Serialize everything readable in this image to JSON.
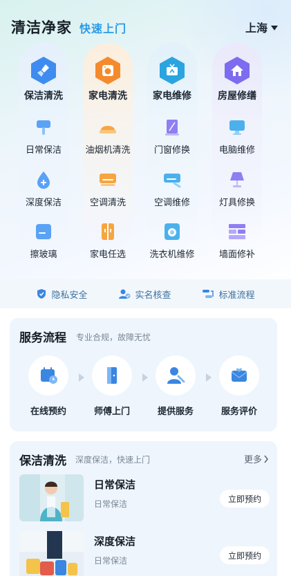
{
  "header": {
    "title": "清洁净家",
    "slogan": "快速上门",
    "city": "上海"
  },
  "categories": {
    "top": [
      {
        "label": "保洁清洗",
        "icon": "broom-icon",
        "color": "#3e8cf0"
      },
      {
        "label": "家电清洗",
        "icon": "washing-machine-icon",
        "color": "#f58a2c"
      },
      {
        "label": "家电维修",
        "icon": "tv-icon",
        "color": "#2ba4e0"
      },
      {
        "label": "房屋修缮",
        "icon": "house-icon",
        "color": "#7d6cf0"
      }
    ],
    "rows": [
      [
        {
          "label": "日常保洁",
          "icon": "mop-icon"
        },
        {
          "label": "油烟机清洗",
          "icon": "range-hood-icon"
        },
        {
          "label": "门窗修换",
          "icon": "window-icon"
        },
        {
          "label": "电脑维修",
          "icon": "computer-icon"
        }
      ],
      [
        {
          "label": "深度保洁",
          "icon": "drop-plus-icon"
        },
        {
          "label": "空调清洗",
          "icon": "air-conditioner-icon"
        },
        {
          "label": "空调维修",
          "icon": "ac-repair-icon"
        },
        {
          "label": "灯具修换",
          "icon": "lamp-icon"
        }
      ],
      [
        {
          "label": "擦玻璃",
          "icon": "glass-wipe-icon"
        },
        {
          "label": "家电任选",
          "icon": "fridge-icon"
        },
        {
          "label": "洗衣机维修",
          "icon": "washer-icon"
        },
        {
          "label": "墙面修补",
          "icon": "brick-wall-icon"
        }
      ]
    ]
  },
  "trust": [
    {
      "label": "隐私安全",
      "icon": "shield-icon"
    },
    {
      "label": "实名核查",
      "icon": "user-check-icon"
    },
    {
      "label": "标准流程",
      "icon": "flow-icon"
    }
  ],
  "process": {
    "title": "服务流程",
    "subtitle": "专业合规，故障无忧",
    "steps": [
      {
        "label": "在线预约",
        "icon": "calendar-clock-icon"
      },
      {
        "label": "师傅上门",
        "icon": "door-icon"
      },
      {
        "label": "提供服务",
        "icon": "worker-icon"
      },
      {
        "label": "服务评价",
        "icon": "mail-heart-icon"
      }
    ]
  },
  "clean": {
    "title": "保洁清洗",
    "subtitle": "深度保洁，快速上门",
    "more": "更多",
    "items": [
      {
        "title": "日常保洁",
        "sub": "日常保洁",
        "button": "立即预约"
      },
      {
        "title": "深度保洁",
        "sub": "日常保洁",
        "button": "立即预约"
      }
    ]
  },
  "colors": {
    "accent": "#2a9be8",
    "primary_blue": "#3e8cf0",
    "orange": "#f58a2c",
    "purple": "#7d6cf0"
  }
}
